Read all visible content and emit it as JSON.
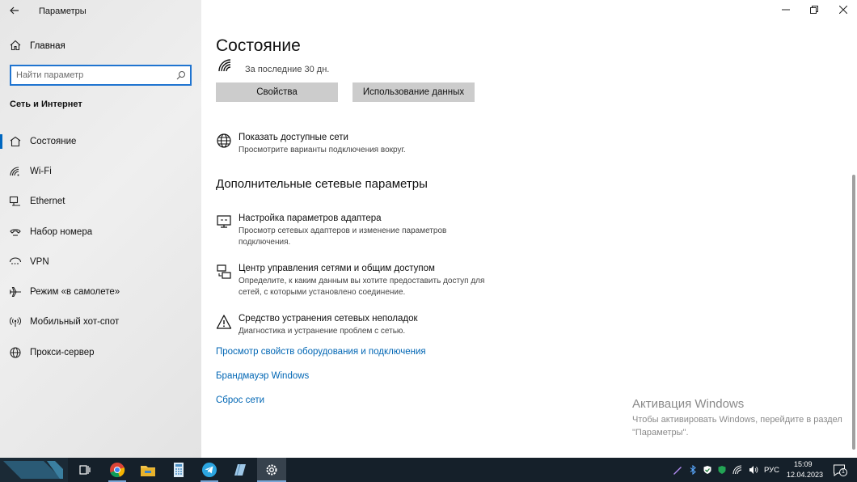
{
  "app": {
    "title": "Параметры"
  },
  "sidebar": {
    "home_label": "Главная",
    "search_placeholder": "Найти параметр",
    "section_title": "Сеть и Интернет",
    "items": [
      {
        "label": "Состояние",
        "icon": "home-network-icon",
        "active": true
      },
      {
        "label": "Wi-Fi",
        "icon": "wifi-icon"
      },
      {
        "label": "Ethernet",
        "icon": "ethernet-icon"
      },
      {
        "label": "Набор номера",
        "icon": "dialup-icon"
      },
      {
        "label": "VPN",
        "icon": "vpn-icon"
      },
      {
        "label": "Режим «в самолете»",
        "icon": "airplane-icon"
      },
      {
        "label": "Мобильный хот-спот",
        "icon": "hotspot-icon"
      },
      {
        "label": "Прокси-сервер",
        "icon": "globe-icon"
      }
    ]
  },
  "main": {
    "title": "Состояние",
    "period_text": "За последние 30 дн.",
    "buttons": {
      "properties": "Свойства",
      "data_usage": "Использование данных"
    },
    "show_networks": {
      "title": "Показать доступные сети",
      "desc": "Просмотрите варианты подключения вокруг."
    },
    "advanced_heading": "Дополнительные сетевые параметры",
    "adapter": {
      "title": "Настройка параметров адаптера",
      "desc": "Просмотр сетевых адаптеров и изменение параметров подключения."
    },
    "sharing_center": {
      "title": "Центр управления сетями и общим доступом",
      "desc": "Определите, к каким данным вы хотите предоставить доступ для сетей, с которыми установлено соединение."
    },
    "troubleshooter": {
      "title": "Средство устранения сетевых неполадок",
      "desc": "Диагностика и устранение проблем с сетью."
    },
    "links": {
      "hardware": "Просмотр свойств оборудования и подключения",
      "firewall": "Брандмауэр Windows",
      "reset": "Сброс сети"
    }
  },
  "activation": {
    "title": "Активация Windows",
    "text": "Чтобы активировать Windows, перейдите в раздел \"Параметры\"."
  },
  "taskbar": {
    "language": "РУС",
    "time": "15:09",
    "date": "12.04.2023",
    "notification_count": "1"
  },
  "colors": {
    "accent": "#0067c0",
    "link": "#0066b4",
    "taskbar": "#15202a"
  }
}
